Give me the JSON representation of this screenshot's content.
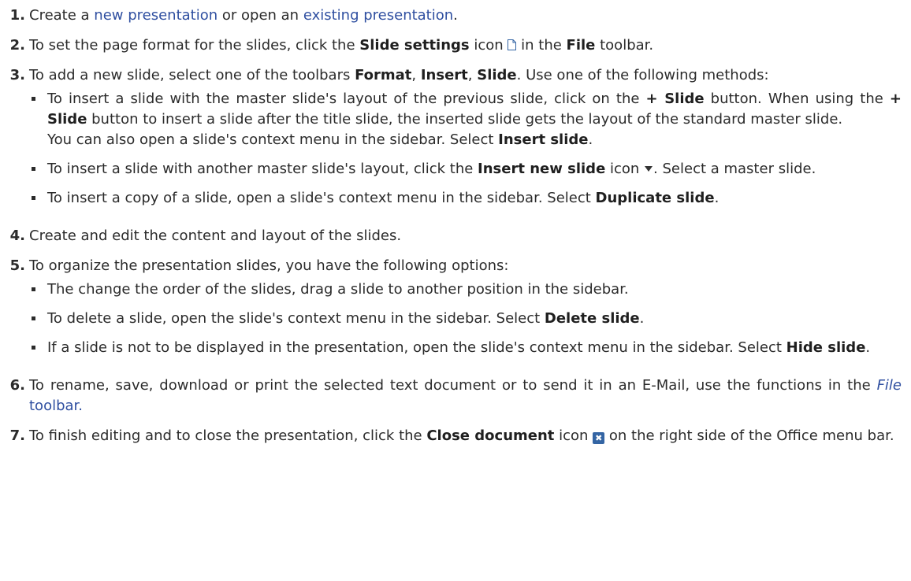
{
  "steps": [
    {
      "num": "1.",
      "pre": "Create a ",
      "link1": "new presentation",
      "mid": " or open an ",
      "link2": "existing presentation",
      "post": "."
    },
    {
      "num": "2.",
      "t1": "To set the page format for the slides, click the ",
      "b1": "Slide settings",
      "t2": " icon ",
      "t3": " in the ",
      "b2": "File",
      "t4": " toolbar."
    },
    {
      "num": "3.",
      "t1": "To add a new slide, select one of the toolbars ",
      "b1": "Format",
      "t2": ", ",
      "b2": "Insert",
      "t3": ", ",
      "b3": "Slide",
      "t4": ". Use one of the following methods:",
      "subs": [
        {
          "t1": "To insert a slide with the master slide's layout of the previous slide, click on the ",
          "b1": "+ Slide",
          "t2": " button. When using the ",
          "b2": "+ Slide",
          "t3": " button to insert a slide after the title slide, the inserted slide gets the layout of the standard master slide.",
          "t4": "You can also open a slide's context menu in the sidebar. Select ",
          "b3": "Insert slide",
          "t5": "."
        },
        {
          "t1": "To insert a slide with another master slide's layout, click the ",
          "b1": "Insert new slide",
          "t2": " icon ",
          "t3": ". Select a master slide."
        },
        {
          "t1": "To insert a copy of a slide, open a slide's context menu in the sidebar. Select ",
          "b1": "Duplicate slide",
          "t2": "."
        }
      ]
    },
    {
      "num": "4.",
      "text": "Create and edit the content and layout of the slides."
    },
    {
      "num": "5.",
      "text": "To organize the presentation slides, you have the following options:",
      "subs": [
        {
          "t1": "The change the order of the slides, drag a slide to another position in the sidebar."
        },
        {
          "t1": "To delete a slide, open the slide's context menu in the sidebar. Select ",
          "b1": "Delete slide",
          "t2": "."
        },
        {
          "t1": "If a slide is not to be displayed in the presentation, open the slide's context menu in the sidebar. Select ",
          "b1": "Hide slide",
          "t2": "."
        }
      ]
    },
    {
      "num": "6.",
      "t1": "To rename, save, download or print the selected text document or to send it in an E-Mail, use the functions in the ",
      "i1": "File",
      "t2": " toolbar."
    },
    {
      "num": "7.",
      "t1": "To finish editing and to close the presentation, click the ",
      "b1": "Close document",
      "t2": " icon ",
      "t3": " on the right side of the Office menu bar."
    }
  ],
  "icons": {
    "slide_settings": "page-icon",
    "insert_new_slide": "triangle-down-icon",
    "close_document": "close-icon",
    "close_glyph": "✖",
    "close_color": "#3465a4",
    "link_color": "#2f4fa0"
  }
}
